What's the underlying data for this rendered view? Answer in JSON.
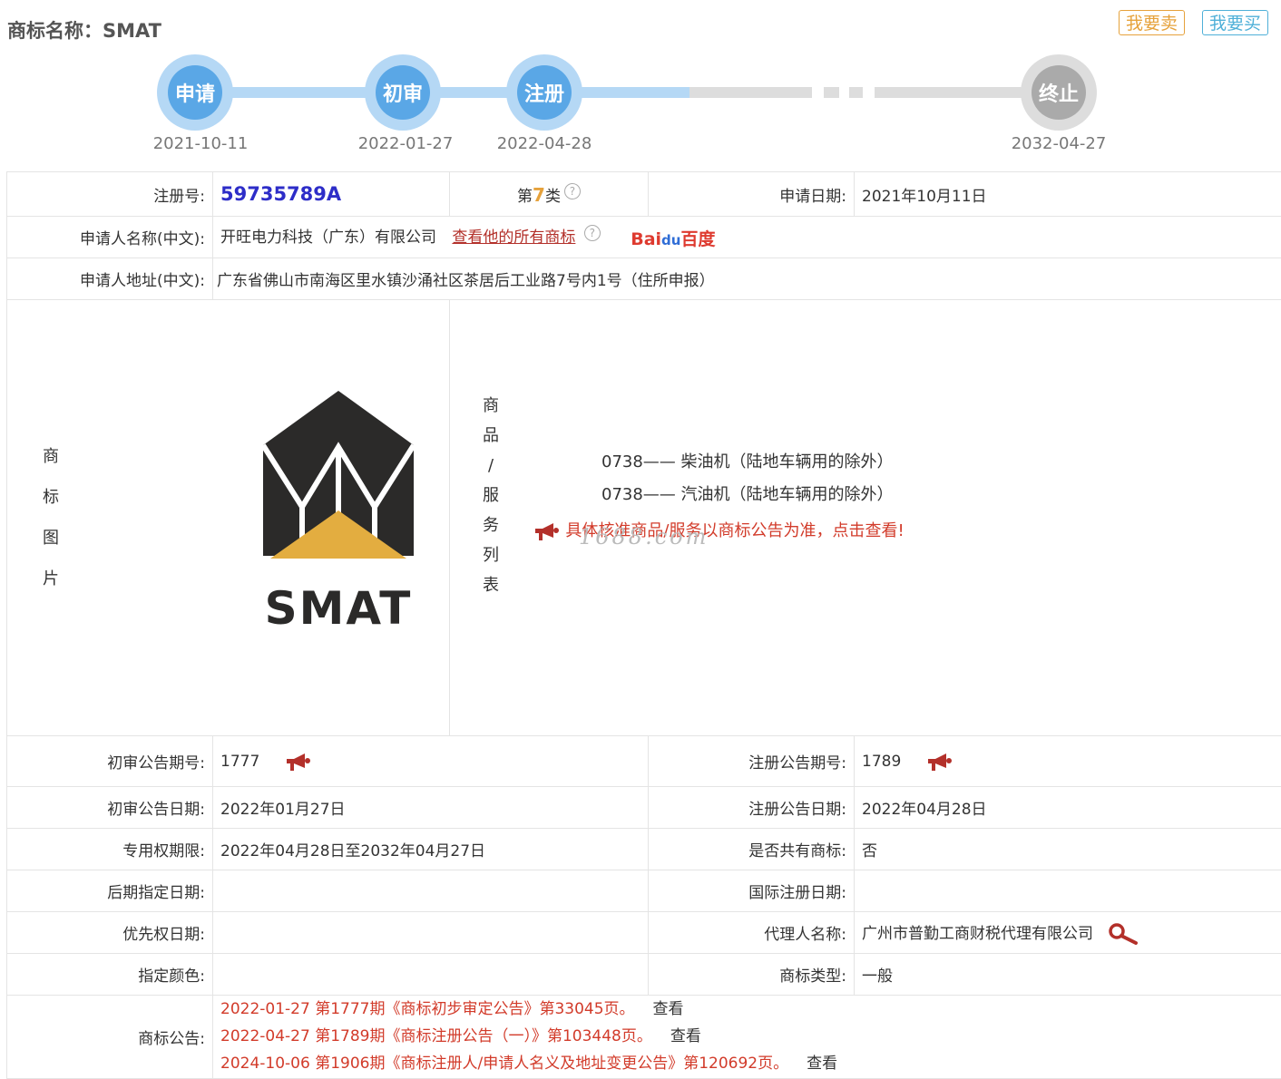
{
  "header": {
    "title": "商标名称：SMAT",
    "sell_button": "我要卖",
    "buy_button": "我要买"
  },
  "timeline": {
    "nodes": [
      {
        "label": "申请",
        "date": "2021-10-11"
      },
      {
        "label": "初审",
        "date": "2022-01-27"
      },
      {
        "label": "注册",
        "date": "2022-04-28"
      },
      {
        "label": "终止",
        "date": "2032-04-27"
      }
    ]
  },
  "info": {
    "reg_no_label": "注册号:",
    "reg_no": "59735789A",
    "class_prefix": "第",
    "class_num": "7",
    "class_suffix": "类",
    "apply_date_label": "申请日期:",
    "apply_date": "2021年10月11日",
    "applicant_label": "申请人名称(中文):",
    "applicant": "开旺电力科技（广东）有限公司",
    "all_marks_link": "查看他的所有商标",
    "baidu": {
      "bai": "Bai",
      "du": "du",
      "text": "百度"
    },
    "address_label": "申请人地址(中文):",
    "address": "广东省佛山市南海区里水镇沙涌社区茶居后工业路7号内1号（住所申报）",
    "image_label_chars": [
      "商",
      "标",
      "图",
      "片"
    ],
    "logo_text": "SMAT",
    "goods_label_chars": [
      "商",
      "品",
      "/",
      "服",
      "务",
      "列",
      "表"
    ],
    "goods": [
      "0738—— 柴油机（陆地车辆用的除外）",
      "0738—— 汽油机（陆地车辆用的除外）"
    ],
    "goods_notice": "具体核准商品/服务以商标公告为准，点击查看!",
    "watermark": "1688.com",
    "prelim_no_label": "初审公告期号:",
    "prelim_no": "1777",
    "reg_pub_no_label": "注册公告期号:",
    "reg_pub_no": "1789",
    "prelim_date_label": "初审公告日期:",
    "prelim_date": "2022年01月27日",
    "reg_pub_date_label": "注册公告日期:",
    "reg_pub_date": "2022年04月28日",
    "term_label": "专用权期限:",
    "term": "2022年04月28日至2032年04月27日",
    "shared_label": "是否共有商标:",
    "shared": "否",
    "later_label": "后期指定日期:",
    "intl_label": "国际注册日期:",
    "priority_label": "优先权日期:",
    "agent_label": "代理人名称:",
    "agent": "广州市普勤工商财税代理有限公司",
    "color_label": "指定颜色:",
    "type_label": "商标类型:",
    "type": "一般",
    "announce_label": "商标公告:",
    "announcements": [
      {
        "text": "2022-01-27 第1777期《商标初步审定公告》第33045页。",
        "view": "查看"
      },
      {
        "text": "2022-04-27 第1789期《商标注册公告（一）》第103448页。",
        "view": "查看"
      },
      {
        "text": "2024-10-06 第1906期《商标注册人/申请人名义及地址变更公告》第120692页。",
        "view": "查看"
      }
    ]
  },
  "colors": {
    "blue_node": "#5aa7e6",
    "gray_node": "#aaaaaa",
    "red_link": "#d23b2a",
    "reg_no": "#2d2dc8"
  }
}
